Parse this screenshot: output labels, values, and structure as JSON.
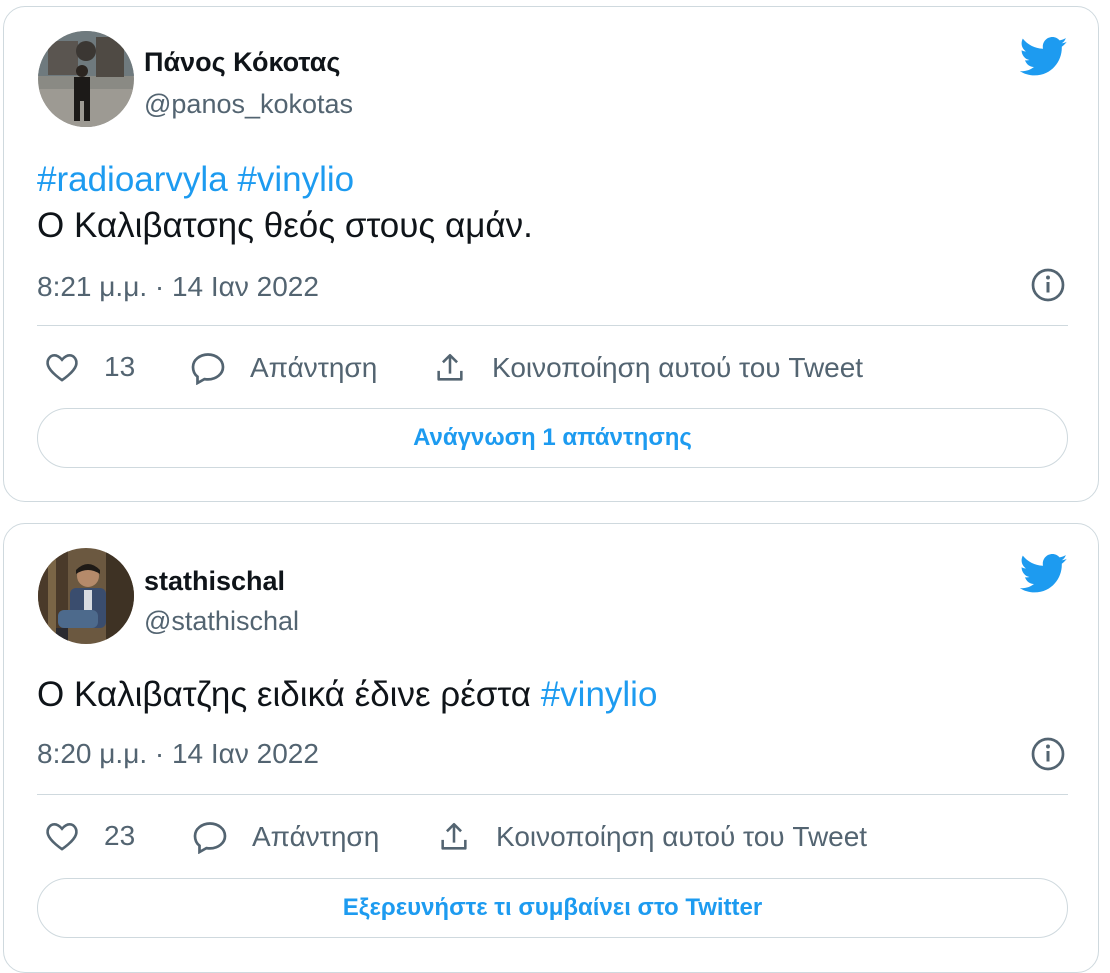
{
  "colors": {
    "link": "#1d9bf0",
    "text": "#0f1419",
    "muted": "#536471",
    "border": "#cfd9de"
  },
  "tweets": [
    {
      "author_name": "Πάνος Κόκοτας",
      "author_handle": "@panos_kokotas",
      "hashtags": "#radioarvyla #vinylio",
      "text": "Ο Καλιβατσης θεός στους αμάν.",
      "timestamp": "8:21 μ.μ. · 14 Ιαν 2022",
      "likes": "13",
      "reply_label": "Απάντηση",
      "share_label": "Κοινοποίηση αυτού του Tweet",
      "cta_label": "Ανάγνωση 1 απάντησης"
    },
    {
      "author_name": "stathischal",
      "author_handle": "@stathischal",
      "text": "Ο Καλιβατζης ειδικά έδινε ρέστα ",
      "hashtags": "#vinylio",
      "timestamp": "8:20 μ.μ. · 14 Ιαν 2022",
      "likes": "23",
      "reply_label": "Απάντηση",
      "share_label": "Κοινοποίηση αυτού του Tweet",
      "cta_label": "Εξερευνήστε τι συμβαίνει στο Twitter"
    }
  ],
  "icons": [
    "avatar",
    "twitter-bird-icon",
    "info-icon",
    "heart-icon",
    "reply-icon",
    "share-icon"
  ]
}
